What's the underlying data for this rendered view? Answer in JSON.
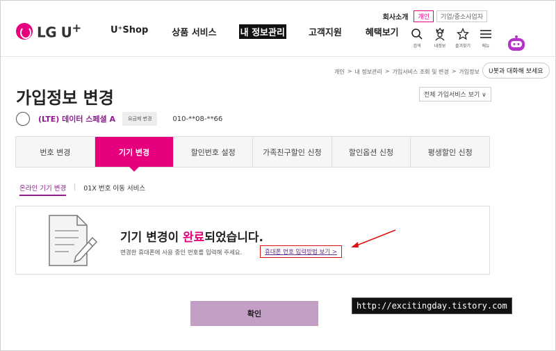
{
  "header": {
    "logo_text": "LG U",
    "logo_plus": "+",
    "nav": [
      "U⁺Shop",
      "상품 서비스",
      "내 정보관리",
      "고객지원",
      "혜택보기"
    ],
    "nav_active_index": 2,
    "util_company": "회사소개",
    "util_tabs": [
      "개인",
      "기업/중소사업자"
    ],
    "util_active_tab": "개인",
    "icons": [
      {
        "name": "search-icon",
        "label": "검색"
      },
      {
        "name": "my-info-icon",
        "label": "내정보"
      },
      {
        "name": "favorites-icon",
        "label": "즐겨찾기"
      },
      {
        "name": "menu-icon",
        "label": "메뉴"
      }
    ]
  },
  "chatbot": {
    "bubble": "U봇과 대화해 보세요"
  },
  "breadcrumb": [
    "개인",
    "내 정보관리",
    "가입서비스 조회 및 변경",
    "가입정보"
  ],
  "page": {
    "title": "가입정보 변경",
    "all_services": "전체 가입서비스 보기 ∨"
  },
  "plan": {
    "name": "(LTE) 데이터 스페셜 A",
    "change_button": "요금제 변경",
    "phone": "010-**08-**66"
  },
  "tabs": [
    "번호 변경",
    "기기 변경",
    "할인번호 설정",
    "가족친구할인 신청",
    "할인옵션 신청",
    "평생할인 신청"
  ],
  "active_tab": "기기 변경",
  "subtabs": [
    "온라인 기기 변경",
    "01X 번호 이동 서비스"
  ],
  "result": {
    "title_pre": "기기 변경이 ",
    "title_highlight": "완료",
    "title_post": "되었습니다.",
    "subtext": "변경한 휴대폰에 사용 중인 번호를 입력해 주세요.",
    "link": "휴대폰 번호 입력방법 보기 >"
  },
  "confirm_label": "확인",
  "watermark": "http://excitingday.tistory.com",
  "colors": {
    "brand": "#e6007e",
    "purple": "#8e1c8f",
    "confirm_bg": "#c39fc6"
  }
}
